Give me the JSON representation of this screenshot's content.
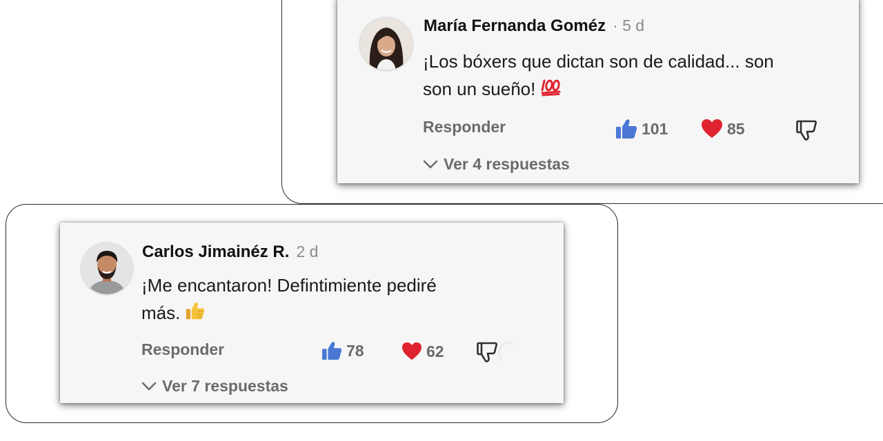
{
  "comments": [
    {
      "author": "María Fernanda Goméz",
      "meta": "· 5 d",
      "text_line1": "¡Los bóxers que dictan son de calidad...  son",
      "text_line2": "son un sueño!",
      "text_emoji": "hundred-points-emoji",
      "reply_label": "Responder",
      "likes": "101",
      "hearts": "85",
      "replies_label": "Ver 4 respuestas"
    },
    {
      "author": "Carlos Jimainéz R.",
      "meta": "2 d",
      "text_line1": "¡Me encantaron! Defintimiente pediré",
      "text_line2": "más.",
      "text_emoji": "thumbs-up-emoji",
      "reply_label": "Responder",
      "likes": "78",
      "hearts": "62",
      "replies_label": "Ver 7 respuestas"
    }
  ],
  "icons": {
    "like": "thumbs-up-icon",
    "heart": "heart-icon",
    "dislike": "thumbs-down-icon",
    "expand": "chevron-down-icon"
  },
  "colors": {
    "like_blue": "#4a78d4",
    "heart_red": "#e0242f",
    "hundred_red": "#e0242f",
    "thumb_yellow": "#f5c33b"
  }
}
